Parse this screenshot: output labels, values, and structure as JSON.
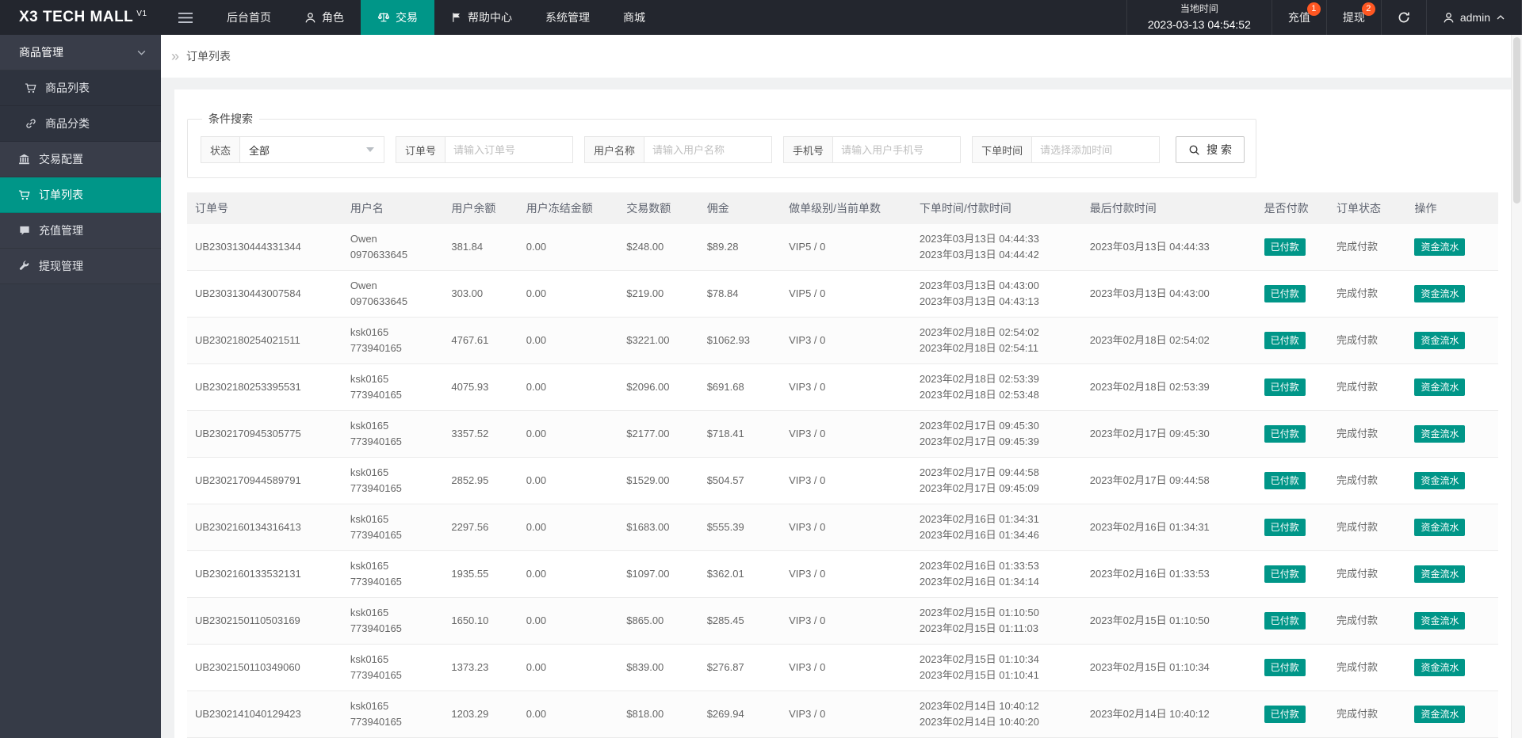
{
  "app": {
    "accent_color": "#009688",
    "header_bg": "#23262e",
    "sidebar_bg": "#393d49",
    "badge_color": "#ff5722"
  },
  "header": {
    "logo": "X3 TECH MALL",
    "logo_version": "V1",
    "nav": [
      {
        "key": "dashboard",
        "label": "后台首页"
      },
      {
        "key": "role",
        "label": "角色",
        "icon": "person"
      },
      {
        "key": "trade",
        "label": "交易",
        "icon": "scales",
        "active": true
      },
      {
        "key": "help-center",
        "label": "帮助中心",
        "icon": "flag"
      },
      {
        "key": "system-manage",
        "label": "系统管理"
      },
      {
        "key": "mall",
        "label": "商城"
      }
    ],
    "local_time_label": "当地时间",
    "local_time": "2023-03-13 04:54:52",
    "recharge": {
      "label": "充值",
      "badge": "1"
    },
    "withdraw": {
      "label": "提现",
      "badge": "2"
    },
    "user": {
      "name": "admin"
    }
  },
  "sidebar": {
    "items": [
      {
        "key": "goods-manage",
        "label": "商品管理",
        "type": "group",
        "expanded": true
      },
      {
        "key": "goods-list",
        "label": "商品列表",
        "type": "child",
        "icon": "cart"
      },
      {
        "key": "goods-category",
        "label": "商品分类",
        "type": "child",
        "icon": "link"
      },
      {
        "key": "trade-config",
        "label": "交易配置",
        "type": "item",
        "icon": "bank"
      },
      {
        "key": "order-list",
        "label": "订单列表",
        "type": "item",
        "icon": "cart",
        "active": true
      },
      {
        "key": "recharge-manage",
        "label": "充值管理",
        "type": "item",
        "icon": "comment"
      },
      {
        "key": "withdraw-manage",
        "label": "提现管理",
        "type": "item",
        "icon": "wrench"
      }
    ]
  },
  "breadcrumb": {
    "icon": "»",
    "title": "订单列表"
  },
  "filters": {
    "legend": "条件搜索",
    "status": {
      "label": "状态",
      "value": "全部"
    },
    "order_no": {
      "label": "订单号",
      "placeholder": "请输入订单号"
    },
    "user_name": {
      "label": "用户名称",
      "placeholder": "请输入用户名称"
    },
    "phone": {
      "label": "手机号",
      "placeholder": "请输入用户手机号"
    },
    "order_time": {
      "label": "下单时间",
      "placeholder": "请选择添加时间"
    },
    "search_label": "搜 索"
  },
  "table": {
    "columns": [
      "订单号",
      "用户名",
      "用户余额",
      "用户冻结金额",
      "交易数额",
      "佣金",
      "做单级别/当前单数",
      "下单时间/付款时间",
      "最后付款时间",
      "是否付款",
      "订单状态",
      "操作"
    ],
    "rows": [
      {
        "order": "UB2303130444331344",
        "user_name": "Owen",
        "user_account": "0970633645",
        "balance": "381.84",
        "frozen": "0.00",
        "amount": "$248.00",
        "commission": "$89.28",
        "level": "VIP5 / 0",
        "time_order": "2023年03月13日 04:44:33",
        "time_pay": "2023年03月13日 04:44:42",
        "last_pay": "2023年03月13日 04:44:33",
        "paid_label": "已付款",
        "status_label": "完成付款",
        "action_label": "资金流水"
      },
      {
        "order": "UB2303130443007584",
        "user_name": "Owen",
        "user_account": "0970633645",
        "balance": "303.00",
        "frozen": "0.00",
        "amount": "$219.00",
        "commission": "$78.84",
        "level": "VIP5 / 0",
        "time_order": "2023年03月13日 04:43:00",
        "time_pay": "2023年03月13日 04:43:13",
        "last_pay": "2023年03月13日 04:43:00",
        "paid_label": "已付款",
        "status_label": "完成付款",
        "action_label": "资金流水"
      },
      {
        "order": "UB2302180254021511",
        "user_name": "ksk0165",
        "user_account": "773940165",
        "balance": "4767.61",
        "frozen": "0.00",
        "amount": "$3221.00",
        "commission": "$1062.93",
        "level": "VIP3 / 0",
        "time_order": "2023年02月18日 02:54:02",
        "time_pay": "2023年02月18日 02:54:11",
        "last_pay": "2023年02月18日 02:54:02",
        "paid_label": "已付款",
        "status_label": "完成付款",
        "action_label": "资金流水"
      },
      {
        "order": "UB2302180253395531",
        "user_name": "ksk0165",
        "user_account": "773940165",
        "balance": "4075.93",
        "frozen": "0.00",
        "amount": "$2096.00",
        "commission": "$691.68",
        "level": "VIP3 / 0",
        "time_order": "2023年02月18日 02:53:39",
        "time_pay": "2023年02月18日 02:53:48",
        "last_pay": "2023年02月18日 02:53:39",
        "paid_label": "已付款",
        "status_label": "完成付款",
        "action_label": "资金流水"
      },
      {
        "order": "UB2302170945305775",
        "user_name": "ksk0165",
        "user_account": "773940165",
        "balance": "3357.52",
        "frozen": "0.00",
        "amount": "$2177.00",
        "commission": "$718.41",
        "level": "VIP3 / 0",
        "time_order": "2023年02月17日 09:45:30",
        "time_pay": "2023年02月17日 09:45:39",
        "last_pay": "2023年02月17日 09:45:30",
        "paid_label": "已付款",
        "status_label": "完成付款",
        "action_label": "资金流水"
      },
      {
        "order": "UB2302170944589791",
        "user_name": "ksk0165",
        "user_account": "773940165",
        "balance": "2852.95",
        "frozen": "0.00",
        "amount": "$1529.00",
        "commission": "$504.57",
        "level": "VIP3 / 0",
        "time_order": "2023年02月17日 09:44:58",
        "time_pay": "2023年02月17日 09:45:09",
        "last_pay": "2023年02月17日 09:44:58",
        "paid_label": "已付款",
        "status_label": "完成付款",
        "action_label": "资金流水"
      },
      {
        "order": "UB2302160134316413",
        "user_name": "ksk0165",
        "user_account": "773940165",
        "balance": "2297.56",
        "frozen": "0.00",
        "amount": "$1683.00",
        "commission": "$555.39",
        "level": "VIP3 / 0",
        "time_order": "2023年02月16日 01:34:31",
        "time_pay": "2023年02月16日 01:34:46",
        "last_pay": "2023年02月16日 01:34:31",
        "paid_label": "已付款",
        "status_label": "完成付款",
        "action_label": "资金流水"
      },
      {
        "order": "UB2302160133532131",
        "user_name": "ksk0165",
        "user_account": "773940165",
        "balance": "1935.55",
        "frozen": "0.00",
        "amount": "$1097.00",
        "commission": "$362.01",
        "level": "VIP3 / 0",
        "time_order": "2023年02月16日 01:33:53",
        "time_pay": "2023年02月16日 01:34:14",
        "last_pay": "2023年02月16日 01:33:53",
        "paid_label": "已付款",
        "status_label": "完成付款",
        "action_label": "资金流水"
      },
      {
        "order": "UB2302150110503169",
        "user_name": "ksk0165",
        "user_account": "773940165",
        "balance": "1650.10",
        "frozen": "0.00",
        "amount": "$865.00",
        "commission": "$285.45",
        "level": "VIP3 / 0",
        "time_order": "2023年02月15日 01:10:50",
        "time_pay": "2023年02月15日 01:11:03",
        "last_pay": "2023年02月15日 01:10:50",
        "paid_label": "已付款",
        "status_label": "完成付款",
        "action_label": "资金流水"
      },
      {
        "order": "UB2302150110349060",
        "user_name": "ksk0165",
        "user_account": "773940165",
        "balance": "1373.23",
        "frozen": "0.00",
        "amount": "$839.00",
        "commission": "$276.87",
        "level": "VIP3 / 0",
        "time_order": "2023年02月15日 01:10:34",
        "time_pay": "2023年02月15日 01:10:41",
        "last_pay": "2023年02月15日 01:10:34",
        "paid_label": "已付款",
        "status_label": "完成付款",
        "action_label": "资金流水"
      },
      {
        "order": "UB2302141040129423",
        "user_name": "ksk0165",
        "user_account": "773940165",
        "balance": "1203.29",
        "frozen": "0.00",
        "amount": "$818.00",
        "commission": "$269.94",
        "level": "VIP3 / 0",
        "time_order": "2023年02月14日 10:40:12",
        "time_pay": "2023年02月14日 10:40:20",
        "last_pay": "2023年02月14日 10:40:12",
        "paid_label": "已付款",
        "status_label": "完成付款",
        "action_label": "资金流水"
      }
    ]
  }
}
